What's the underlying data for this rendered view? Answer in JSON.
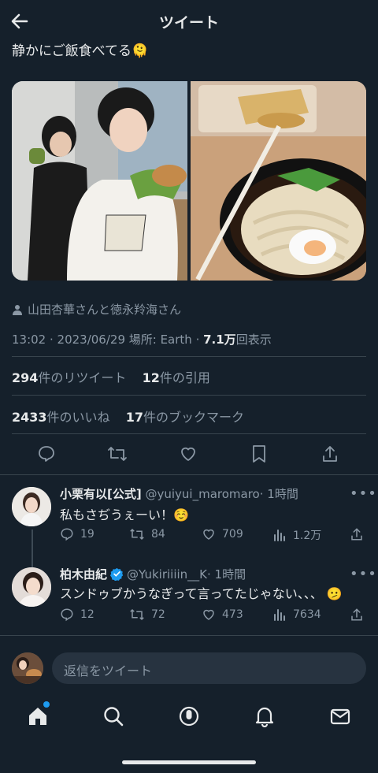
{
  "header": {
    "title": "ツイート"
  },
  "tweet": {
    "text": "静かにご飯食べてる",
    "emoji": "🫠",
    "tagged": "山田杏華さんと徳永羚海さん",
    "meta_prefix": "13:02 · 2023/06/29 場所: Earth · ",
    "views_num": "7.1万",
    "views_label": "回表示",
    "retweets_num": "294",
    "retweets_label": "件のリツイート",
    "quotes_num": "12",
    "quotes_label": "件の引用",
    "likes_num": "2433",
    "likes_label": "件のいいね",
    "bookmarks_num": "17",
    "bookmarks_label": "件のブックマーク"
  },
  "replies": [
    {
      "name": "小栗有以[公式]",
      "handle": "@yuiyui_maromaro",
      "time": "· 1時間",
      "text": "私もさぢうぇーい！",
      "emoji": "☺️",
      "replies": "19",
      "retweets": "84",
      "likes": "709",
      "views": "1.2万"
    },
    {
      "name": "柏木由紀",
      "handle": "@Yukiriiiin__K",
      "time": "· 1時間",
      "text": "スンドゥブかうなぎって言ってたじゃない、、、",
      "emoji": "🫤",
      "replies": "12",
      "retweets": "72",
      "likes": "473",
      "views": "7634"
    }
  ],
  "compose": {
    "placeholder": "返信をツイート"
  },
  "colors": {
    "background": "#15202b",
    "accent": "#1d9bf0",
    "muted": "#8b98a5"
  }
}
